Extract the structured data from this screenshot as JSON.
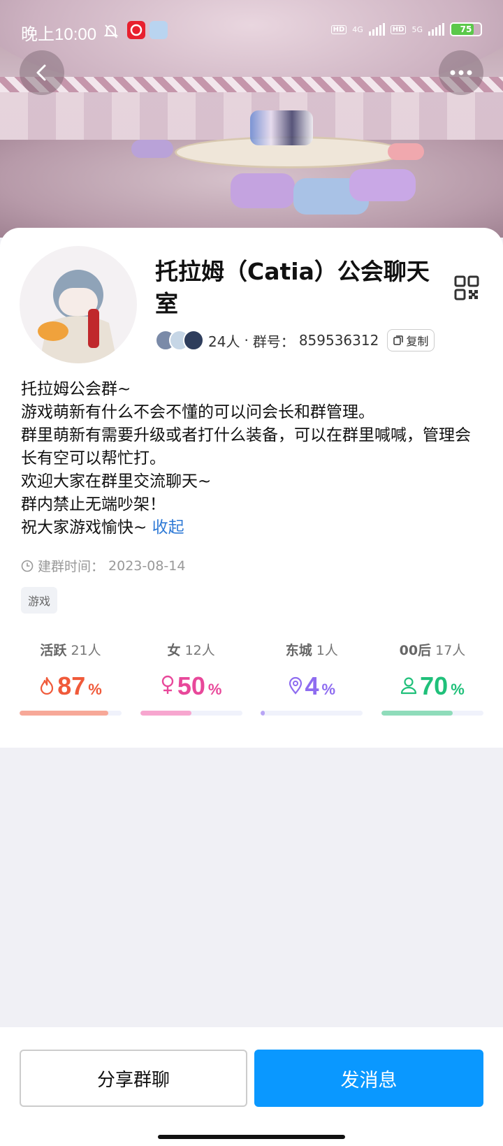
{
  "status": {
    "time": "晚上10:00",
    "net1": "4G",
    "net2": "5G",
    "battery": "75",
    "battery_level": 0.75
  },
  "nav": {
    "back_icon": "chevron-left-icon",
    "more_icon": "more-dots-icon"
  },
  "group": {
    "name": "托拉姆（Catia）公会聊天室",
    "member_count": "24人",
    "separator": "·",
    "group_no_label": "群号：",
    "group_no": "859536312",
    "copy_label": "复制",
    "description_lines": [
      "托拉姆公会群~",
      "游戏萌新有什么不会不懂的可以问会长和群管理。",
      "群里萌新有需要升级或者打什么装备，可以在群里喊喊，管理会长有空可以帮忙打。",
      "欢迎大家在群里交流聊天~",
      "群内禁止无端吵架！",
      "祝大家游戏愉快~"
    ],
    "collapse_label": "收起",
    "created_label": "建群时间：",
    "created_date": "2023-08-14",
    "tag": "游戏"
  },
  "stats": [
    {
      "label": "活跃",
      "count": "21人",
      "value": "87",
      "unit": "%",
      "icon": "flame-icon",
      "color": "#f05a3a",
      "bar_color": "#f7a898",
      "fraction": 0.87
    },
    {
      "label": "女",
      "count": "12人",
      "value": "50",
      "unit": "%",
      "icon": "female-icon",
      "color": "#e8489a",
      "bar_color": "#f7a6cf",
      "fraction": 0.5
    },
    {
      "label": "东城",
      "count": "1人",
      "value": "4",
      "unit": "%",
      "icon": "location-pin-icon",
      "color": "#8e6cf0",
      "bar_color": "#b8a5f5",
      "fraction": 0.04
    },
    {
      "label": "00后",
      "count": "17人",
      "value": "70",
      "unit": "%",
      "icon": "person-icon",
      "color": "#20c07a",
      "bar_color": "#8fdcba",
      "fraction": 0.7
    }
  ],
  "actions": {
    "share_label": "分享群聊",
    "send_label": "发消息"
  }
}
